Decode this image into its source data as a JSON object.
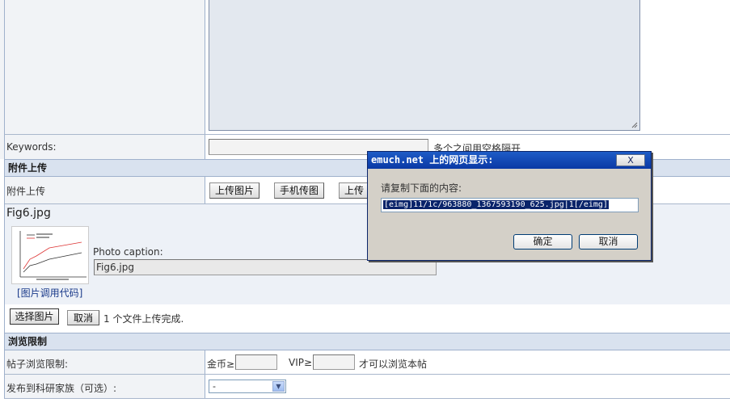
{
  "keywords_row": {
    "label": "Keywords:",
    "hint": "多个之间用空格隔开"
  },
  "attach_section": {
    "title": "附件上传"
  },
  "attach_row": {
    "label": "附件上传",
    "buttons": [
      "上传图片",
      "手机传图",
      "上传"
    ]
  },
  "file": {
    "name": "Fig6.jpg",
    "caption_label": "Photo caption:",
    "caption_value": "Fig6.jpg",
    "code_link": "[图片调用代码]"
  },
  "upload_actions": {
    "choose_label": "选择图片",
    "cancel_label": "取消",
    "status": "1 个文件上传完成."
  },
  "browse_section": {
    "title": "浏览限制"
  },
  "browse_row": {
    "label": "帖子浏览限制:",
    "gold_label": "金币≥",
    "vip_label": "VIP≥",
    "suffix": "才可以浏览本帖"
  },
  "family_row": {
    "label": "发布到科研家族（可选）:",
    "selected": "-"
  },
  "dialog": {
    "title": "emuch.net 上的网页显示:",
    "close_label": "X",
    "message": "请复制下面的内容:",
    "value": "[eimg]11/1c/963880_1367593190_625.jpg|1[/eimg]",
    "ok_label": "确定",
    "cancel_label": "取消"
  },
  "colors": {
    "dialog_title": "#0a38a5",
    "section_bg": "#d9e2ef",
    "selection": "#0a246a"
  }
}
